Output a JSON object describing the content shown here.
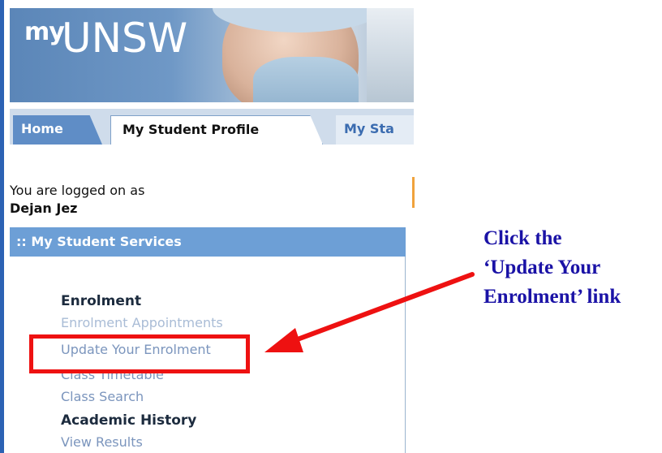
{
  "header": {
    "logo_prefix": "my",
    "logo_name": "UNSW"
  },
  "tabs": [
    {
      "label": "Home"
    },
    {
      "label": "My Student Profile"
    },
    {
      "label": "My Sta"
    }
  ],
  "session": {
    "logged_on_text": "You are logged on as",
    "user_name": "Dejan Jez"
  },
  "services": {
    "title": ":: My Student Services",
    "sections": [
      {
        "heading": "Enrolment",
        "links": [
          "Enrolment Appointments",
          "Update Your Enrolment",
          "Class Timetable",
          "Class Search"
        ]
      },
      {
        "heading": "Academic History",
        "links": [
          "View Results"
        ]
      }
    ]
  },
  "annotation": {
    "line1": "Click the",
    "line2": "‘Update Your",
    "line3": "Enrolment’ link",
    "highlight_color": "#ee1111",
    "text_color": "#1a12a6"
  },
  "colors": {
    "accent_blue": "#6d9fd6",
    "link_color": "#7b95bd",
    "tab_home_bg": "#5f8dc6"
  }
}
